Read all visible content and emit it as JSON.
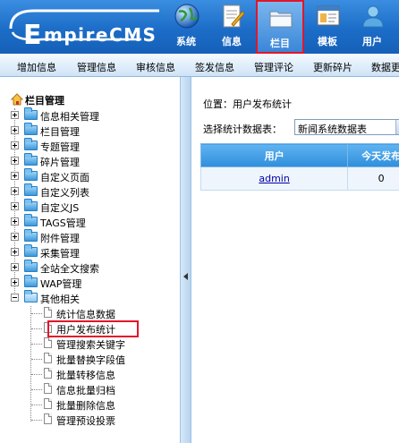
{
  "header": {
    "logo_text": "mpireCMS",
    "logo_letter": "E",
    "nav": [
      {
        "label": "系统",
        "icon": "globe-icon"
      },
      {
        "label": "信息",
        "icon": "document-edit-icon"
      },
      {
        "label": "栏目",
        "icon": "folder-icon"
      },
      {
        "label": "模板",
        "icon": "template-window-icon"
      },
      {
        "label": "用户",
        "icon": "user-icon"
      }
    ],
    "active": "栏目"
  },
  "subnav": {
    "items": [
      "增加信息",
      "管理信息",
      "审核信息",
      "签发信息",
      "管理评论",
      "更新碎片",
      "数据更新"
    ]
  },
  "sidebar": {
    "root_label": "栏目管理",
    "items": [
      {
        "label": "信息相关管理"
      },
      {
        "label": "栏目管理"
      },
      {
        "label": "专题管理"
      },
      {
        "label": "碎片管理"
      },
      {
        "label": "自定义页面"
      },
      {
        "label": "自定义列表"
      },
      {
        "label": "自定义JS"
      },
      {
        "label": "TAGS管理"
      },
      {
        "label": "附件管理"
      },
      {
        "label": "采集管理"
      },
      {
        "label": "全站全文搜索"
      },
      {
        "label": "WAP管理"
      },
      {
        "label": "其他相关"
      }
    ],
    "children": [
      {
        "label": "统计信息数据"
      },
      {
        "label": "用户发布统计"
      },
      {
        "label": "管理搜索关键字"
      },
      {
        "label": "批量替换字段值"
      },
      {
        "label": "批量转移信息"
      },
      {
        "label": "信息批量归档"
      },
      {
        "label": "批量删除信息"
      },
      {
        "label": "管理预设投票"
      }
    ],
    "selected": "用户发布统计"
  },
  "main": {
    "location": "位置：用户发布统计",
    "select_label": "选择统计数据表：",
    "select_value": "新闻系统数据表",
    "table": {
      "headers": [
        "用户",
        "今天发布"
      ],
      "rows": [
        {
          "user": "admin",
          "today": "0"
        }
      ]
    }
  },
  "colors": {
    "header_blue": "#1c6dc8",
    "highlight_red": "#e2162a",
    "table_header_blue": "#3f9be2"
  }
}
